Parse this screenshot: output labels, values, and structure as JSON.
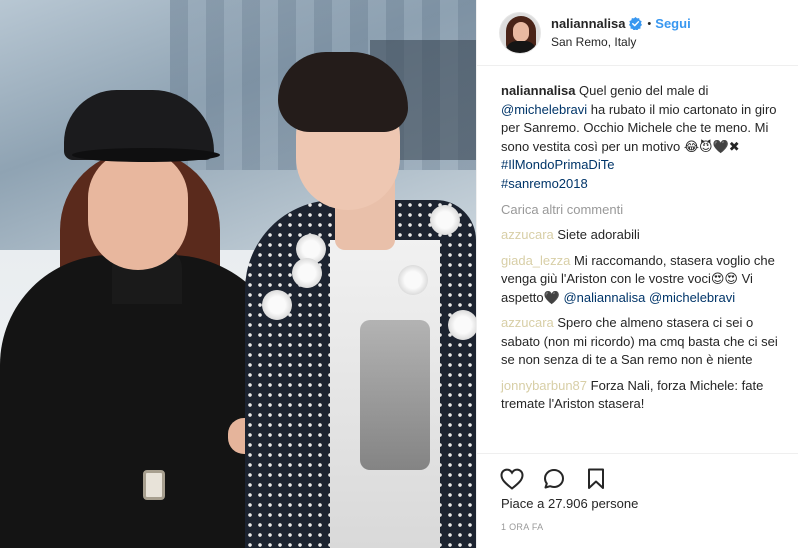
{
  "header": {
    "username": "naliannalisa",
    "separator": "•",
    "follow_label": "Segui",
    "location": "San Remo, Italy"
  },
  "caption": {
    "username": "naliannalisa",
    "text_1": " Quel genio del male di ",
    "mention_1": "@michelebravi",
    "text_2": " ha rubato il mio cartonato in giro per Sanremo. Occhio Michele che te meno. Mi sono vestita così per un motivo ",
    "emojis": "😂😈🖤✖",
    "hashtag_1": "#IlMondoPrimaDiTe",
    "hashtag_2": "#sanremo2018"
  },
  "load_more": "Carica altri commenti",
  "comments": [
    {
      "username": "azzucara",
      "text": " Siete adorabili"
    },
    {
      "username": "giada_lezza",
      "text": " Mi raccomando, stasera voglio che venga giù l'Ariston con le vostre voci😍😍 Vi aspetto🖤 ",
      "mention_1": "@naliannalisa",
      "mention_2": "@michelebravi"
    },
    {
      "username": "azzucara",
      "text": " Spero che almeno stasera ci sei o sabato (non mi ricordo) ma cmq basta che ci sei se non senza di te a San remo non è niente"
    },
    {
      "username": "jonnybarbun87",
      "text": " Forza Nali, forza Michele: fate tremate l'Ariston stasera!"
    }
  ],
  "actions": {
    "like_icon": "heart-outline-icon",
    "comment_icon": "speech-bubble-icon",
    "save_icon": "bookmark-icon"
  },
  "likes_text": "Piace a 27.906 persone",
  "timestamp": "1 ORA FA",
  "colors": {
    "link": "#003569",
    "follow": "#3897f0",
    "verified": "#3897f0",
    "muted": "#999999"
  }
}
